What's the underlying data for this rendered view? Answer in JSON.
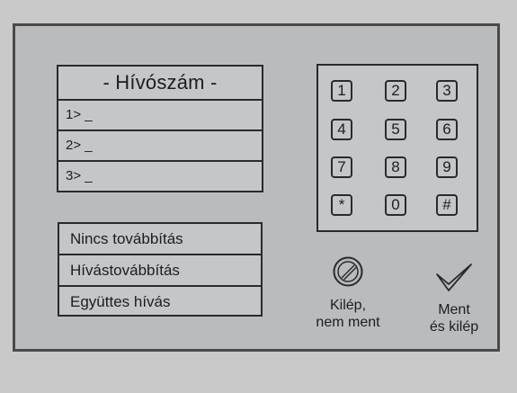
{
  "call_number": {
    "title": "- Hívószám -",
    "entries": [
      "1> _",
      "2> _",
      "3> _"
    ]
  },
  "forward_options": [
    "Nincs továbbítás",
    "Hívástovábbítás",
    "Együttes hívás"
  ],
  "keypad": {
    "keys": [
      "1",
      "2",
      "3",
      "4",
      "5",
      "6",
      "7",
      "8",
      "9",
      "*",
      "0",
      "#"
    ]
  },
  "actions": {
    "cancel_line1": "Kilép,",
    "cancel_line2": "nem ment",
    "save_line1": "Ment",
    "save_line2": "és kilép"
  },
  "icons": {
    "cancel": "no-entry-icon",
    "save": "checkmark-icon"
  }
}
